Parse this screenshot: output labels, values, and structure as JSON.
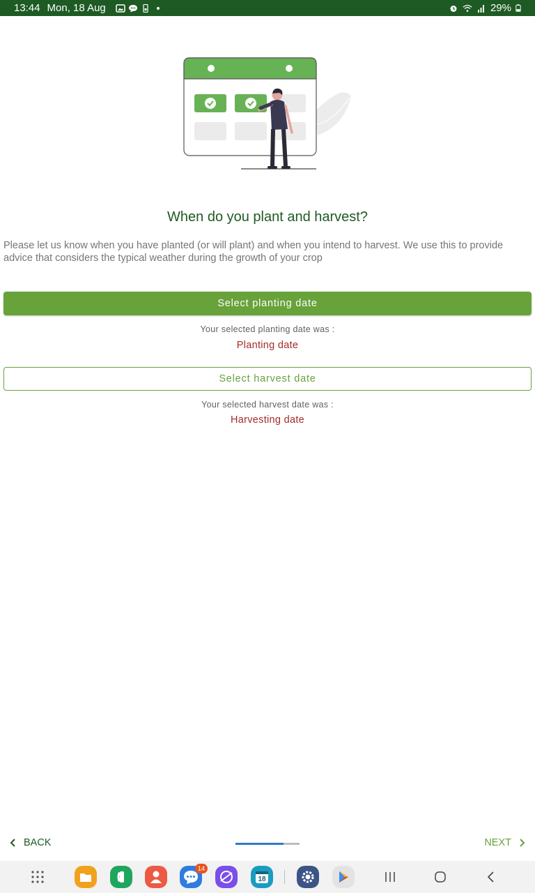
{
  "status_bar": {
    "time": "13:44",
    "date": "Mon, 18 Aug",
    "battery": "29%",
    "icons": [
      "gallery-icon",
      "chat-icon",
      "sim-icon",
      "dot-icon",
      "alarm-icon",
      "wifi-icon",
      "signal-icon",
      "battery-icon"
    ]
  },
  "main": {
    "title": "When do you plant and harvest?",
    "description": "Please let us know when you have planted (or will plant) and when you intend to harvest. We use this to provide advice that considers the typical weather during the growth of your crop",
    "planting": {
      "button_label": "Select planting date",
      "caption": "Your selected planting date was :",
      "value": "Planting date"
    },
    "harvest": {
      "button_label": "Select harvest date",
      "caption": "Your selected harvest date was :",
      "value": "Harvesting date"
    }
  },
  "wizard_nav": {
    "back_label": "BACK",
    "next_label": "NEXT",
    "progress": 0.75
  },
  "system_nav": {
    "messages_badge": "14",
    "calendar_day": "18",
    "apps": [
      "apps-grid-icon",
      "files-icon",
      "phone-icon",
      "contacts-icon",
      "messages-icon",
      "browser-icon",
      "calendar-icon",
      "settings-icon",
      "play-store-icon"
    ]
  },
  "colors": {
    "primary_dark": "#1e5a23",
    "primary": "#68a23a",
    "value_red": "#a52a2a",
    "progress_blue": "#2e7bc9"
  }
}
